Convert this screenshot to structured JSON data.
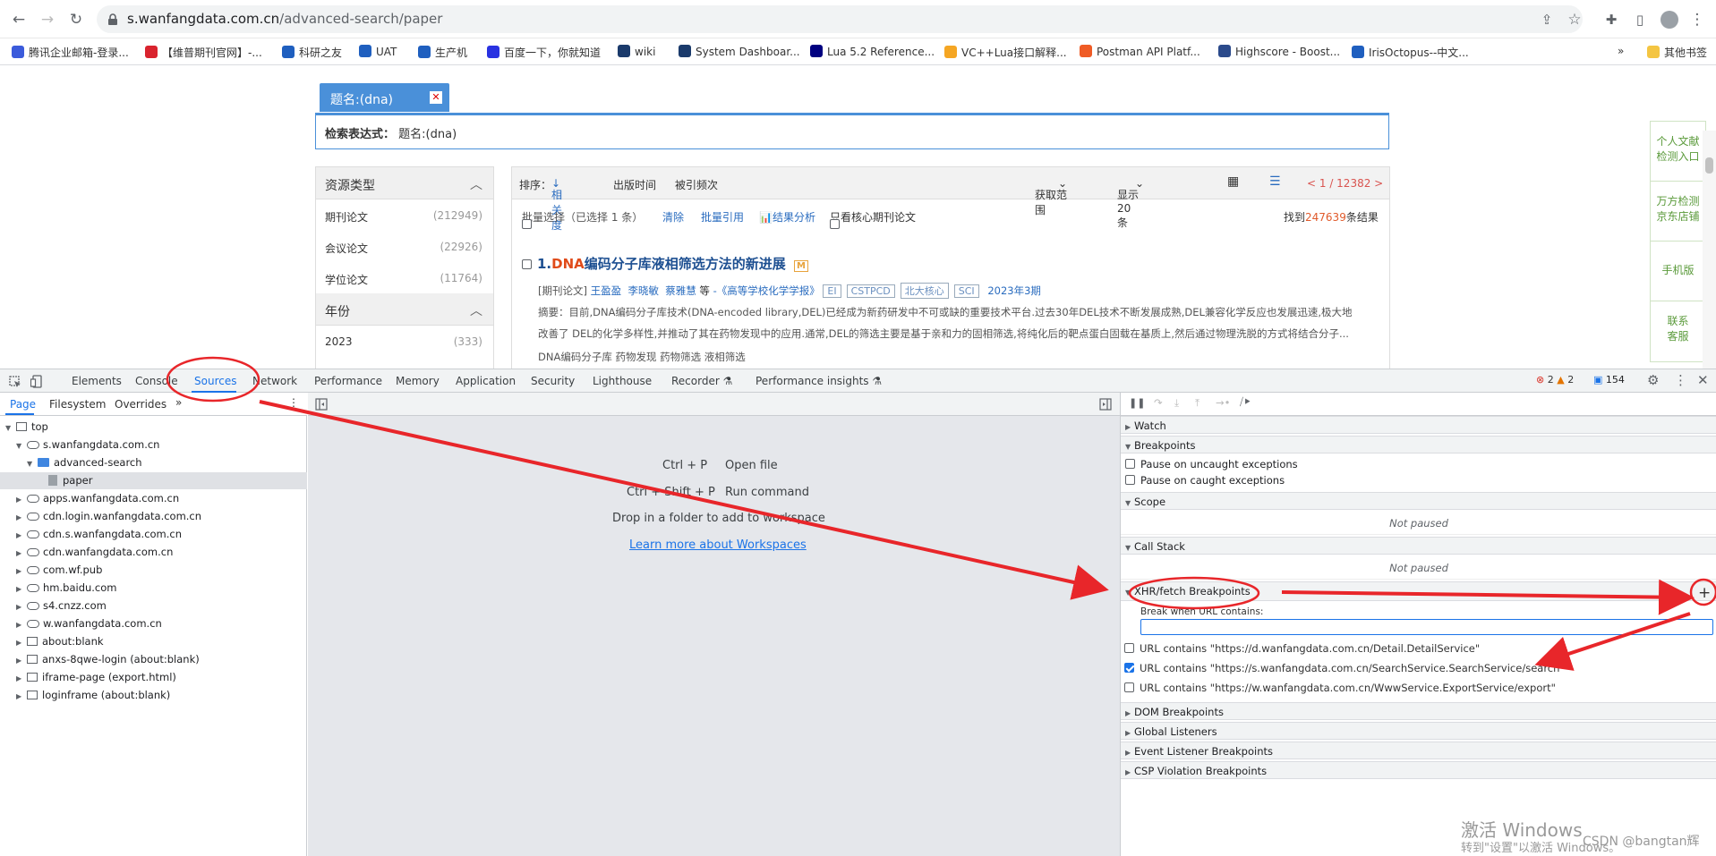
{
  "browser": {
    "url_host": "s.wanfangdata.com.cn",
    "url_path": "/advanced-search/paper",
    "bookmarks": [
      {
        "label": "腾讯企业邮箱-登录...",
        "color": "#3b5bdb"
      },
      {
        "label": "【维普期刊官网】-...",
        "color": "#d9232e"
      },
      {
        "label": "科研之友",
        "color": "#1f5fbf"
      },
      {
        "label": "UAT",
        "color": "#1f5fbf"
      },
      {
        "label": "生产机",
        "color": "#1f5fbf"
      },
      {
        "label": "百度一下，你就知道",
        "color": "#2932e1"
      },
      {
        "label": "wiki",
        "color": "#1a3a6b"
      },
      {
        "label": "System Dashboar...",
        "color": "#1a3a6b"
      },
      {
        "label": "Lua 5.2 Reference...",
        "color": "#000080"
      },
      {
        "label": "VC++Lua接口解释...",
        "color": "#f5a623"
      },
      {
        "label": "Postman API Platf...",
        "color": "#ef5b25"
      },
      {
        "label": "Highscore - Boost...",
        "color": "#2b4a8b"
      },
      {
        "label": "IrisOctopus--中文...",
        "color": "#1f5fbf"
      }
    ],
    "more_bookmarks": "»",
    "other_bookmarks": "其他书签"
  },
  "page": {
    "query_chip": "题名:(dna)",
    "expr_label": "检索表达式：",
    "expr_value": "题名:(dna)",
    "facets": {
      "resource_title": "资源类型",
      "items": [
        {
          "label": "期刊论文",
          "count": "(212949)"
        },
        {
          "label": "会议论文",
          "count": "(22926)"
        },
        {
          "label": "学位论文",
          "count": "(11764)"
        }
      ],
      "year_title": "年份",
      "year_items": [
        {
          "label": "2023",
          "count": "(333)"
        }
      ]
    },
    "sortbar": {
      "label": "排序：",
      "relevance": "相关度",
      "pubtime": "出版时间",
      "cited": "被引频次",
      "range": "获取范围",
      "show": "显示 20 条",
      "pager": "< 1 / 12382 >"
    },
    "toolbar": {
      "batch": "批量选择（已选择 1 条）",
      "clear": "清除",
      "batch_cite": "批量引用",
      "analysis": "结果分析",
      "core_only": "只看核心期刊论文",
      "found_pre": "找到",
      "found_count": "247639",
      "found_post": "条结果"
    },
    "result": {
      "num": "1.",
      "title_hl": "DNA",
      "title_rest": "编码分子库液相筛选方法的新进展",
      "type": "[期刊论文]",
      "authors": [
        "王盈盈",
        "李晓敏",
        "蔡雅慧"
      ],
      "etal": "等",
      "journal": "-《高等学校化学学报》",
      "tags": [
        "EI",
        "CSTPCD",
        "北大核心",
        "SCI"
      ],
      "issue": "2023年3期",
      "abstract1": "摘要：目前,DNA编码分子库技术(DNA-encoded library,DEL)已经成为新药研发中不可或缺的重要技术平台.过去30年DEL技术不断发展成熟,DEL兼容化学反应也发展迅速,极大地",
      "abstract2": "改善了 DEL的化学多样性,并推动了其在药物发现中的应用.通常,DEL的筛选主要是基于亲和力的固相筛选,将纯化后的靶点蛋白固载在基质上,然后通过物理洗脱的方式将结合分子...",
      "keywords": "DNA编码分子库   药物发现   药物筛选   液相筛选"
    },
    "side_widget": [
      "个人文献\n检测入口",
      "万方检测\n京东店铺",
      "手机版",
      "联系\n客服"
    ]
  },
  "devtools": {
    "tabs": [
      "Elements",
      "Console",
      "Sources",
      "Network",
      "Performance",
      "Memory",
      "Application",
      "Security",
      "Lighthouse",
      "Recorder",
      "Performance insights"
    ],
    "errors": "2",
    "warnings": "2",
    "messages": "154",
    "subtabs": [
      "Page",
      "Filesystem",
      "Overrides"
    ],
    "tree": [
      {
        "label": "top",
        "icon": "frame",
        "depth": 0,
        "open": true
      },
      {
        "label": "s.wanfangdata.com.cn",
        "icon": "cloud",
        "depth": 1,
        "open": true
      },
      {
        "label": "advanced-search",
        "icon": "folder",
        "depth": 2,
        "open": true
      },
      {
        "label": "paper",
        "icon": "file",
        "depth": 3,
        "open": false,
        "selected": true
      },
      {
        "label": "apps.wanfangdata.com.cn",
        "icon": "cloud",
        "depth": 1
      },
      {
        "label": "cdn.login.wanfangdata.com.cn",
        "icon": "cloud",
        "depth": 1
      },
      {
        "label": "cdn.s.wanfangdata.com.cn",
        "icon": "cloud",
        "depth": 1
      },
      {
        "label": "cdn.wanfangdata.com.cn",
        "icon": "cloud",
        "depth": 1
      },
      {
        "label": "com.wf.pub",
        "icon": "cloud",
        "depth": 1
      },
      {
        "label": "hm.baidu.com",
        "icon": "cloud",
        "depth": 1
      },
      {
        "label": "s4.cnzz.com",
        "icon": "cloud",
        "depth": 1
      },
      {
        "label": "w.wanfangdata.com.cn",
        "icon": "cloud",
        "depth": 1
      },
      {
        "label": "about:blank",
        "icon": "frame",
        "depth": 1
      },
      {
        "label": "anxs-8qwe-login (about:blank)",
        "icon": "frame",
        "depth": 1
      },
      {
        "label": "iframe-page (export.html)",
        "icon": "frame",
        "depth": 1
      },
      {
        "label": "loginframe (about:blank)",
        "icon": "frame",
        "depth": 1
      }
    ],
    "editor_hints": [
      {
        "keys": "Ctrl + P",
        "action": "Open file"
      },
      {
        "keys": "Ctrl + Shift + P",
        "action": "Run command"
      }
    ],
    "drop_hint": "Drop in a folder to add to workspace",
    "learn_more": "Learn more about Workspaces",
    "right": {
      "watch": "Watch",
      "breakpoints": "Breakpoints",
      "pause_uncaught": "Pause on uncaught exceptions",
      "pause_caught": "Pause on caught exceptions",
      "scope": "Scope",
      "not_paused": "Not paused",
      "call_stack": "Call Stack",
      "xhr": "XHR/fetch Breakpoints",
      "break_when": "Break when URL contains:",
      "xhr_items": [
        {
          "label": "URL contains \"https://d.wanfangdata.com.cn/Detail.DetailService\"",
          "checked": false
        },
        {
          "label": "URL contains \"https://s.wanfangdata.com.cn/SearchService.SearchService/search\"",
          "checked": true
        },
        {
          "label": "URL contains \"https://w.wanfangdata.com.cn/WwwService.ExportService/export\"",
          "checked": false
        }
      ],
      "dom": "DOM Breakpoints",
      "global": "Global Listeners",
      "event": "Event Listener Breakpoints",
      "csp": "CSP Violation Breakpoints"
    }
  },
  "watermark": {
    "line1": "激活 Windows",
    "line2": "转到\"设置\"以激活 Windows。",
    "csdn": "CSDN @bangtan辉"
  },
  "annotation_color": "#e8262a"
}
